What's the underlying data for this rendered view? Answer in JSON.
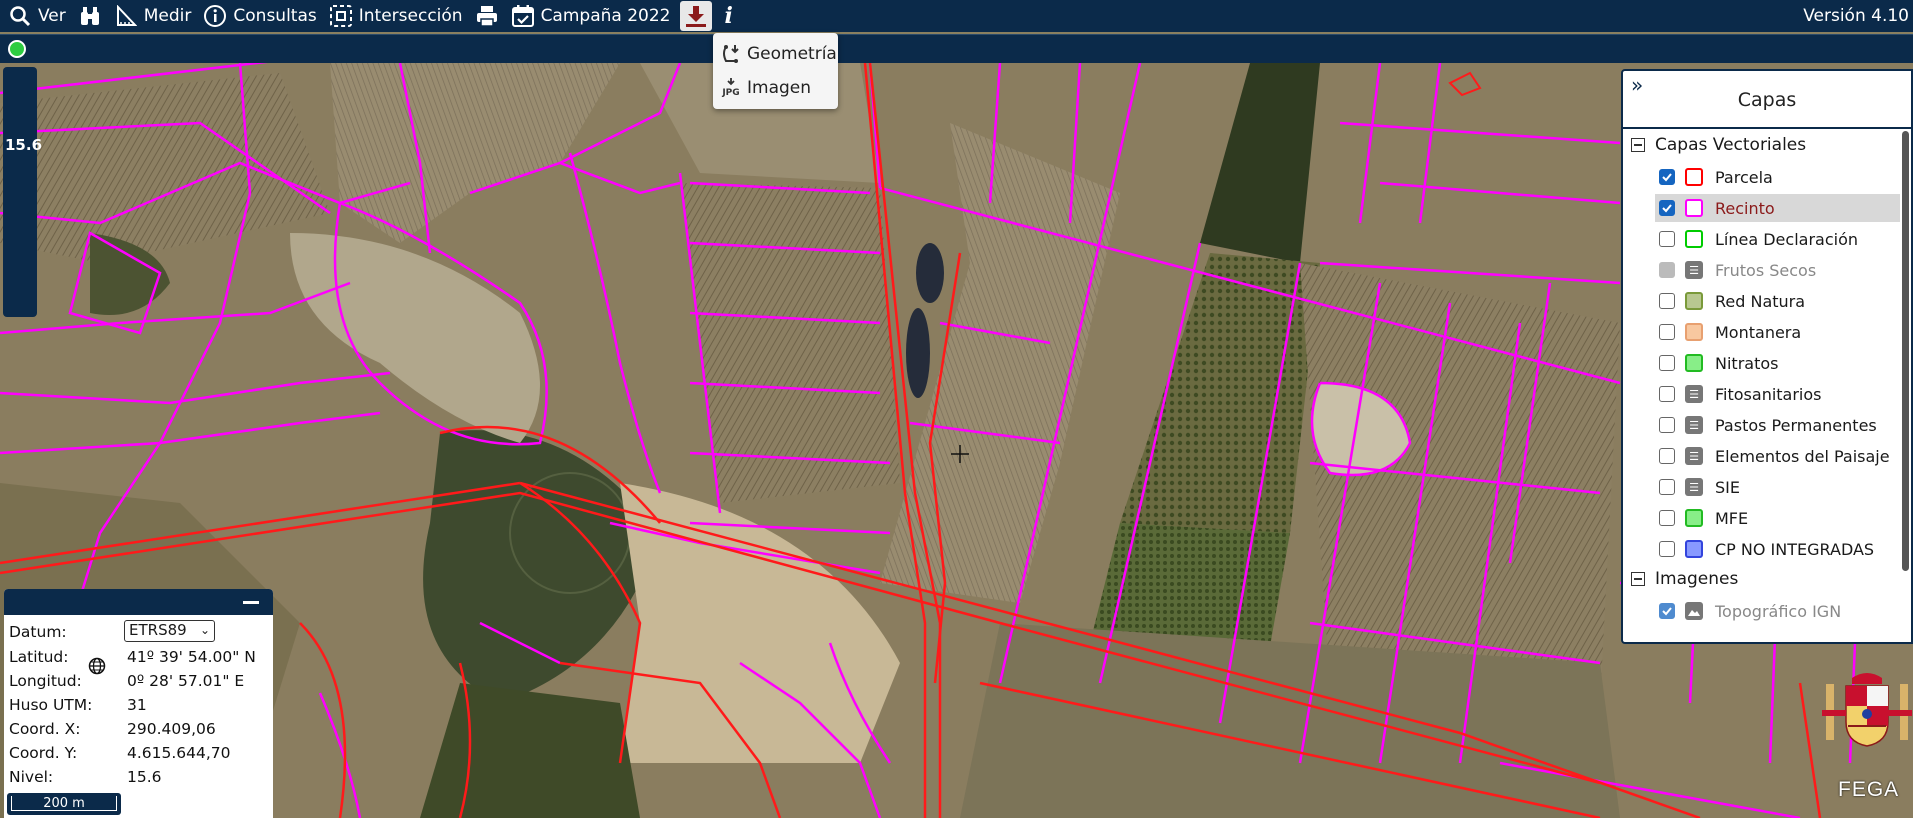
{
  "toolbar": {
    "items": [
      {
        "label": "Ver",
        "icon": "search-icon"
      },
      {
        "label": "",
        "icon": "binoculars-icon"
      },
      {
        "label": "Medir",
        "icon": "ruler-icon"
      },
      {
        "label": "Consultas",
        "icon": "info-circle-icon"
      },
      {
        "label": "Intersección",
        "icon": "intersection-icon"
      },
      {
        "label": "",
        "icon": "print-icon"
      },
      {
        "label": "Campaña 2022",
        "icon": "calendar-check-icon"
      },
      {
        "label": "",
        "icon": "download-icon"
      },
      {
        "label": "i",
        "icon": "info-icon"
      }
    ],
    "version": "Versión 4.10"
  },
  "download_menu": {
    "items": [
      {
        "label": "Geometría",
        "icon": "geometry-download-icon"
      },
      {
        "label": "Imagen",
        "icon": "jpg-download-icon",
        "icon_text": "JPG"
      }
    ]
  },
  "zoom": {
    "level": "15.6"
  },
  "layers_panel": {
    "title": "Capas",
    "groups": [
      {
        "label": "Capas Vectoriales",
        "layers": [
          {
            "name": "Parcela",
            "checked": true,
            "swatch_border": "#ff0000",
            "swatch_fill": "#ffffff",
            "state": "normal"
          },
          {
            "name": "Recinto",
            "checked": true,
            "swatch_border": "#ff00ff",
            "swatch_fill": "#ffffff",
            "state": "selected"
          },
          {
            "name": "Línea Declaración",
            "checked": false,
            "swatch_border": "#00cc00",
            "swatch_fill": "#ffffff",
            "state": "normal"
          },
          {
            "name": "Frutos Secos",
            "checked": false,
            "swatch_type": "list",
            "state": "disabled"
          },
          {
            "name": "Red Natura",
            "checked": false,
            "swatch_border": "#7a9a3a",
            "swatch_fill": "#b8c890",
            "state": "normal"
          },
          {
            "name": "Montanera",
            "checked": false,
            "swatch_border": "#e8a070",
            "swatch_fill": "#f8c8a0",
            "state": "normal"
          },
          {
            "name": "Nitratos",
            "checked": false,
            "swatch_border": "#22bb22",
            "swatch_fill": "#88ee88",
            "state": "normal"
          },
          {
            "name": "Fitosanitarios",
            "checked": false,
            "swatch_type": "list",
            "state": "normal"
          },
          {
            "name": "Pastos Permanentes",
            "checked": false,
            "swatch_type": "list",
            "state": "normal"
          },
          {
            "name": "Elementos del Paisaje",
            "checked": false,
            "swatch_type": "list",
            "state": "normal"
          },
          {
            "name": "SIE",
            "checked": false,
            "swatch_type": "list",
            "state": "normal"
          },
          {
            "name": "MFE",
            "checked": false,
            "swatch_border": "#22bb22",
            "swatch_fill": "#88ee88",
            "state": "normal"
          },
          {
            "name": "CP NO INTEGRADAS",
            "checked": false,
            "swatch_border": "#3344dd",
            "swatch_fill": "#8899ff",
            "state": "normal"
          }
        ]
      },
      {
        "label": "Imagenes",
        "layers": [
          {
            "name": "Topográfico IGN",
            "checked": true,
            "swatch_type": "image",
            "state": "disabled"
          }
        ]
      }
    ]
  },
  "coords_panel": {
    "rows": [
      {
        "label": "Datum:",
        "value": "ETRS89",
        "type": "select"
      },
      {
        "label": "Latitud:",
        "value": "41º 39' 54.00\" N"
      },
      {
        "label": "Longitud:",
        "value": "0º 28' 57.01\" E"
      },
      {
        "label": "Huso UTM:",
        "value": "31"
      },
      {
        "label": "Coord. X:",
        "value": "290.409,06"
      },
      {
        "label": "Coord. Y:",
        "value": "4.615.644,70"
      },
      {
        "label": "Nivel:",
        "value": "15.6"
      }
    ]
  },
  "scale_bar": {
    "label": "200 m"
  },
  "branding": {
    "logo_text": "FEGA"
  },
  "colors": {
    "toolbar_bg": "#0b2a4a",
    "parcel_line": "#ff0000",
    "recinto_line": "#ff00ff",
    "checkbox_on": "#1565c0"
  }
}
